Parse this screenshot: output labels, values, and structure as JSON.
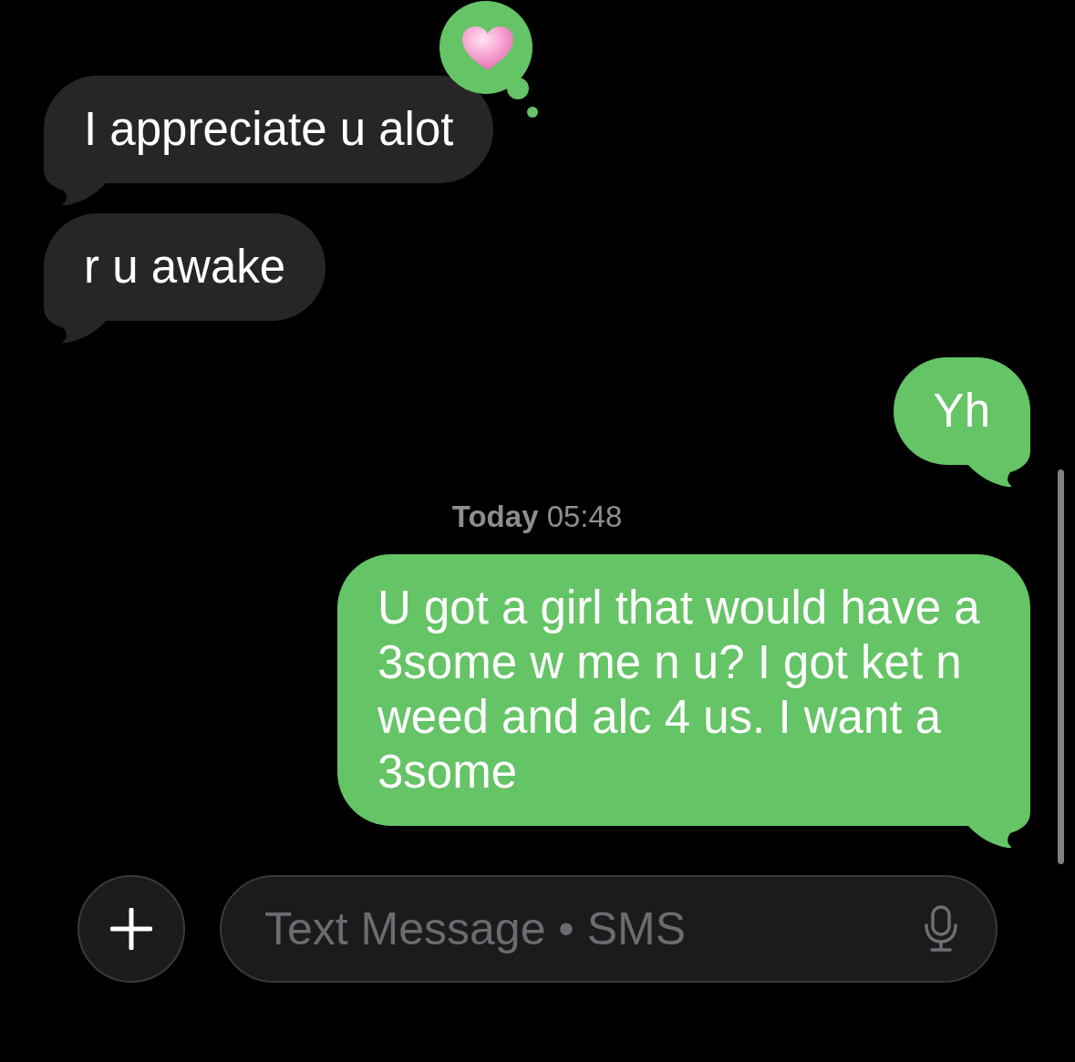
{
  "conversation": [
    {
      "kind": "incoming",
      "text": "I appreciate u alot",
      "reaction": {
        "kind": "heart"
      }
    },
    {
      "kind": "incoming",
      "text": "r u awake"
    },
    {
      "kind": "outgoing",
      "text": "Yh"
    },
    {
      "kind": "timestamp",
      "text": "**Today** 05:48"
    },
    {
      "kind": "outgoing",
      "text": "U got a girl that would have a 3some w me n u? I got ket n weed and alc 4 us. I want a 3some"
    }
  ],
  "composer": {
    "placeholder": "Text Message • SMS"
  }
}
